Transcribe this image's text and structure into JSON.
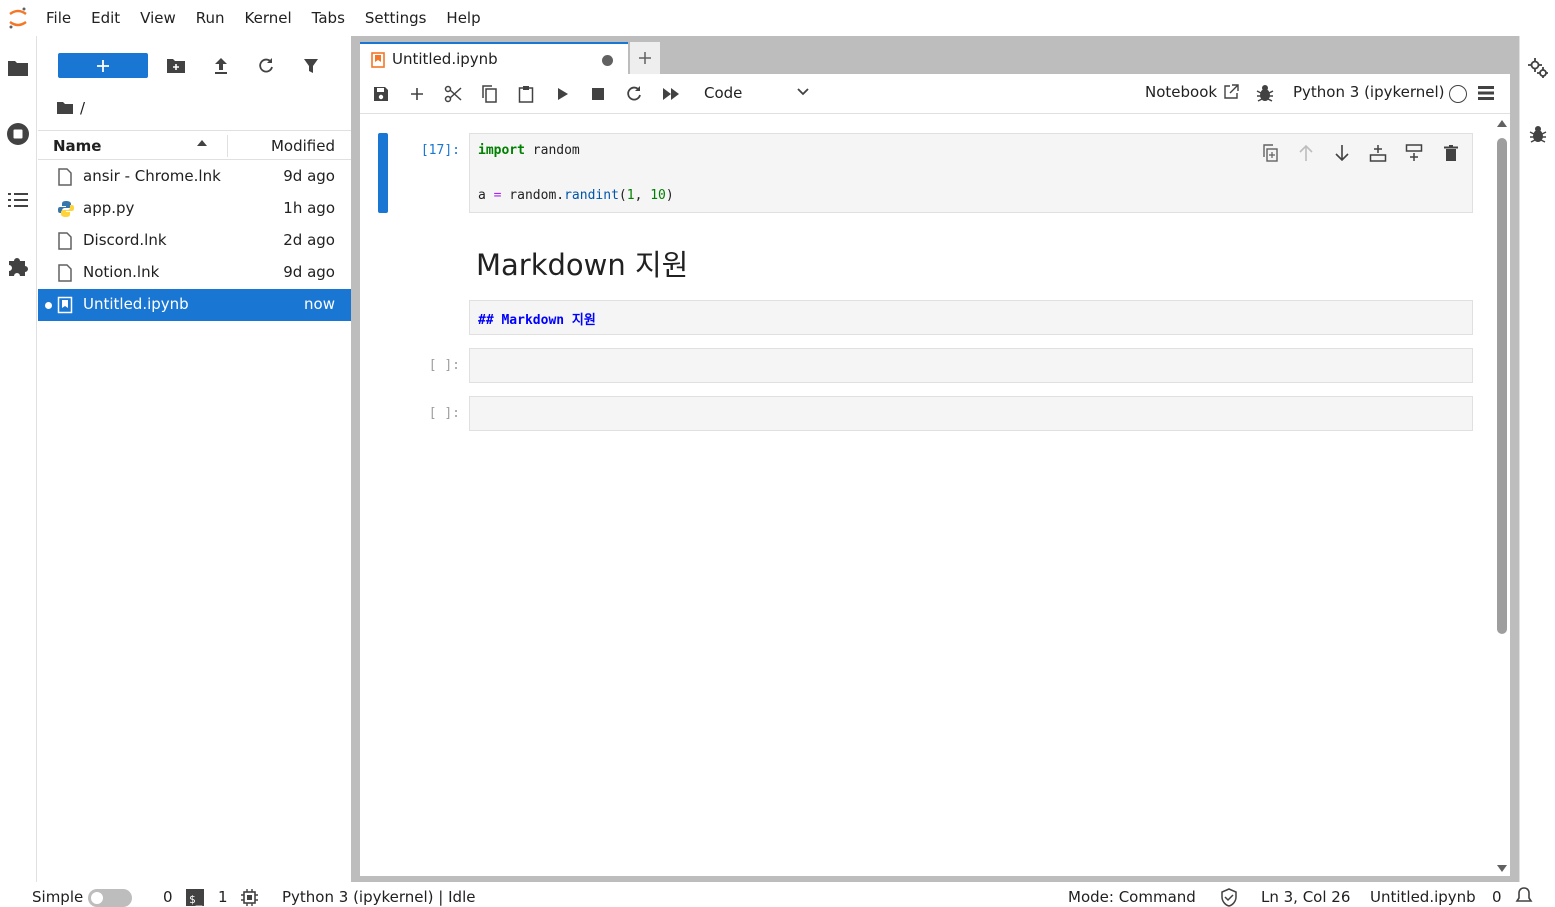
{
  "menu": [
    "File",
    "Edit",
    "View",
    "Run",
    "Kernel",
    "Tabs",
    "Settings",
    "Help"
  ],
  "filebrowser": {
    "breadcrumb": "/",
    "columns": {
      "name": "Name",
      "modified": "Modified"
    },
    "files": [
      {
        "name": "ansir - Chrome.lnk",
        "modified": "9d ago",
        "icon": "file-icon"
      },
      {
        "name": "app.py",
        "modified": "1h ago",
        "icon": "python-icon"
      },
      {
        "name": "Discord.lnk",
        "modified": "2d ago",
        "icon": "file-icon"
      },
      {
        "name": "Notion.lnk",
        "modified": "9d ago",
        "icon": "file-icon"
      },
      {
        "name": "Untitled.ipynb",
        "modified": "now",
        "icon": "notebook-icon",
        "selected": true
      }
    ]
  },
  "tab": {
    "label": "Untitled.ipynb",
    "dirty": true
  },
  "toolbar": {
    "cell_type": "Code",
    "notebook_label": "Notebook",
    "kernel_name": "Python 3 (ipykernel)"
  },
  "cells": [
    {
      "type": "code",
      "prompt": "[17]:",
      "lines": [
        "import random",
        "",
        "a = random.randint(1, 10)"
      ]
    },
    {
      "type": "markdown",
      "rendered": "Markdown 지원",
      "source": "## Markdown 지원"
    },
    {
      "type": "code",
      "prompt": "[ ]:",
      "lines": []
    },
    {
      "type": "code",
      "prompt": "[ ]:",
      "lines": []
    }
  ],
  "status": {
    "mode_label": "Simple",
    "terminals": "0",
    "kernels": "1",
    "kernel_status": "Python 3 (ipykernel) | Idle",
    "mode": "Mode: Command",
    "cursor": "Ln 3, Col 26",
    "file": "Untitled.ipynb",
    "notifications": "0"
  },
  "colors": {
    "accent": "#1976d2",
    "dock_bg": "#bdbdbd"
  }
}
